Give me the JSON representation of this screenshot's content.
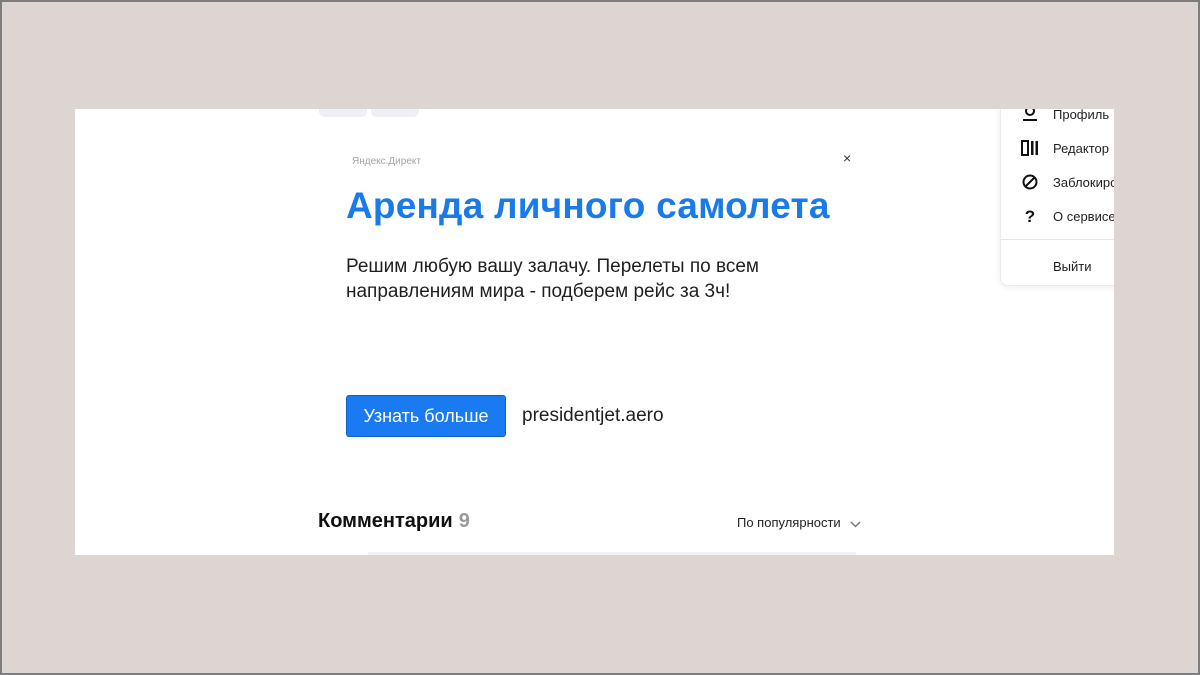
{
  "ad": {
    "source": "Яндекс.Директ",
    "close_icon": "×",
    "title": "Аренда личного самолета",
    "text": "Решим любую вашу залачу. Перелеты по всем направлениям мира - подберем рейс за 3ч!",
    "button_label": "Узнать больше",
    "domain": "presidentjet.aero",
    "accent_color": "#1a7ae8"
  },
  "comments": {
    "title": "Комментарии",
    "count": "9",
    "sort_label": "По популярности"
  },
  "menu": {
    "items": [
      {
        "label": "Профиль",
        "icon": "profile-icon"
      },
      {
        "label": "Редактор",
        "icon": "editor-icon"
      },
      {
        "label": "Заблокиро",
        "icon": "block-icon"
      },
      {
        "label": "О сервисе",
        "icon": "question-icon"
      },
      {
        "label": "Выйти",
        "icon": ""
      }
    ]
  }
}
